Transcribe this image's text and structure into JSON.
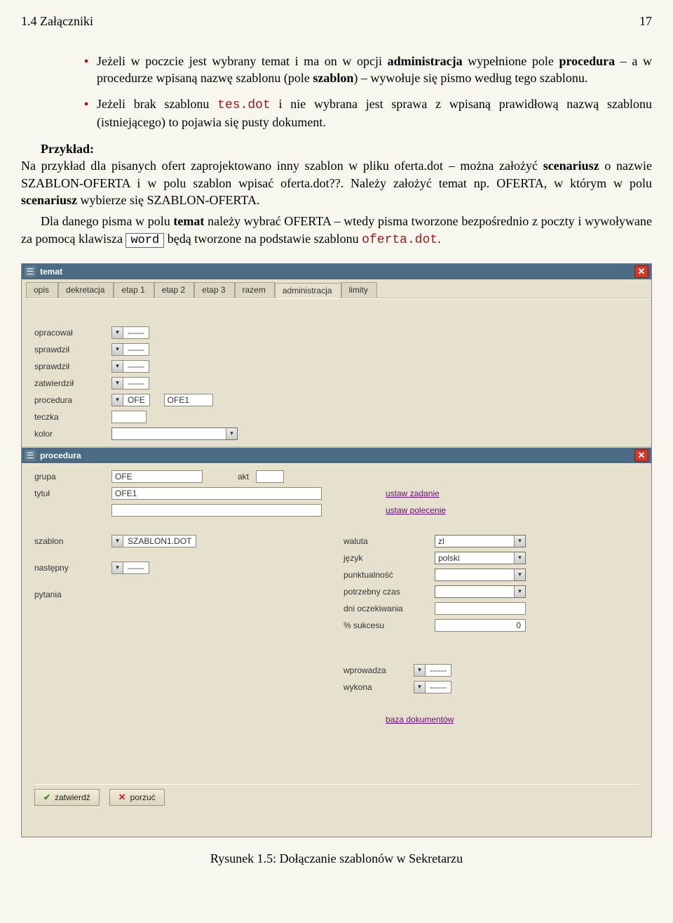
{
  "header": {
    "section": "1.4 Załączniki",
    "page_num": "17"
  },
  "bullets": {
    "b1_a": "Jeżeli w poczcie jest wybrany temat i ma on w opcji ",
    "b1_b": "administracja",
    "b1_c": " wypełnione pole ",
    "b1_d": "procedura",
    "b1_e": " – a w procedurze wpisaną nazwę szablonu (pole ",
    "b1_f": "szablon",
    "b1_g": ") – wywołuje się pismo według tego szablonu.",
    "b2_a": "Jeżeli brak szablonu ",
    "b2_b": "tes.dot",
    "b2_c": " i nie wybrana jest sprawa z wpisaną prawidłową nazwą szablonu (istniejącego) to pojawia się pusty dokument."
  },
  "example": {
    "hdr": "Przykład:",
    "p1_a": "Na przykład dla pisanych ofert zaprojektowano inny szablon w pliku oferta.dot – można założyć ",
    "p1_b": "scenariusz",
    "p1_c": " o nazwie SZABLON-OFERTA i w polu szablon wpisać oferta.dot??. Należy założyć temat np. OFERTA, w którym w polu ",
    "p1_d": "scenariusz",
    "p1_e": " wybierze się SZABLON-OFERTA.",
    "p2_a": "Dla danego pisma w polu ",
    "p2_b": "temat",
    "p2_c": " należy wybrać OFERTA – wtedy pisma tworzone bezpośrednio z poczty i wywoływane za pomocą klawisza ",
    "p2_key": "word",
    "p2_d": " będą tworzone na podstawie szablonu ",
    "p2_e": "oferta.dot",
    "p2_f": "."
  },
  "temat": {
    "title": "temat",
    "tabs": [
      "opis",
      "dekretacja",
      "etap 1",
      "etap 2",
      "etap 3",
      "razem",
      "administracja",
      "limity"
    ],
    "active_tab_index": 6,
    "fields": {
      "opracowal": {
        "label": "opracował",
        "value": "------"
      },
      "sprawdzil1": {
        "label": "sprawdził",
        "value": "------"
      },
      "sprawdzil2": {
        "label": "sprawdził",
        "value": "------"
      },
      "zatwierdzil": {
        "label": "zatwierdził",
        "value": "------"
      },
      "procedura": {
        "label": "procedura",
        "value": "OFE",
        "value2": "OFE1"
      },
      "teczka": {
        "label": "teczka"
      },
      "kolor": {
        "label": "kolor"
      }
    }
  },
  "procedura": {
    "title": "procedura",
    "fields": {
      "grupa": {
        "label": "grupa",
        "value": "OFE"
      },
      "akt": {
        "label": "akt"
      },
      "tytul": {
        "label": "tytuł",
        "value": "OFE1"
      },
      "link1": "ustaw zadanie",
      "link2": "ustaw polecenie",
      "szablon": {
        "label": "szablon",
        "value": "SZABLON1.DOT"
      },
      "nastepny": {
        "label": "następny",
        "value": "------"
      },
      "pytania": {
        "label": "pytania"
      },
      "waluta": {
        "label": "waluta",
        "value": "zl"
      },
      "jezyk": {
        "label": "język",
        "value": "polski"
      },
      "punktualnosc": {
        "label": "punktualność",
        "value": ""
      },
      "czas": {
        "label": "potrzebny czas",
        "value": ""
      },
      "dni": {
        "label": "dni oczekiwania",
        "value": ""
      },
      "sukces": {
        "label": "% sukcesu",
        "value": "0"
      },
      "wprowadza": {
        "label": "wprowadza",
        "value": "------"
      },
      "wykona": {
        "label": "wykona",
        "value": "------"
      },
      "link3": "baza dokumentów"
    },
    "buttons": {
      "confirm": "zatwierdź",
      "cancel": "porzuć"
    }
  },
  "caption": "Rysunek 1.5: Dołączanie szablonów w Sekretarzu"
}
